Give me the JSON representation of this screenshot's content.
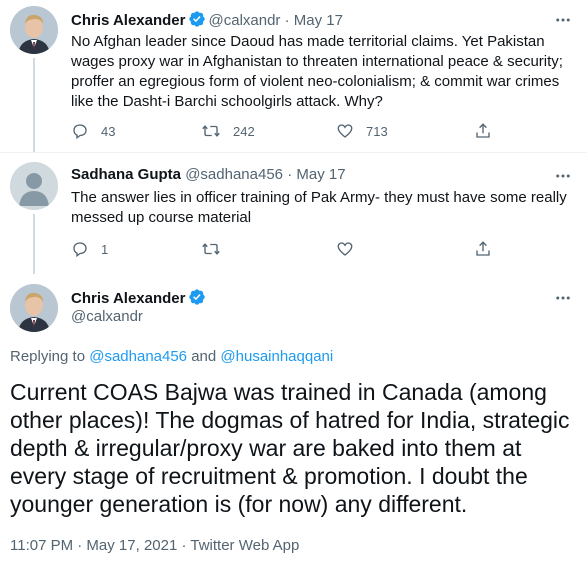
{
  "tweets": [
    {
      "name": "Chris Alexander",
      "handle": "@calxandr",
      "separator": "·",
      "date": "May 17",
      "text": "No Afghan leader since Daoud has made territorial claims. Yet Pakistan wages proxy war in Afghanistan to threaten international peace & security; proffer an egregious form of violent neo-colonialism; & commit war crimes like the Dasht-i Barchi schoolgirls attack. Why?",
      "replies": "43",
      "retweets": "242",
      "likes": "713"
    },
    {
      "name": "Sadhana Gupta",
      "handle": "@sadhana456",
      "separator": "·",
      "date": "May 17",
      "text": "The answer lies in officer training of Pak Army- they must have some really messed up course material",
      "replies": "1",
      "retweets": "",
      "likes": ""
    }
  ],
  "main_tweet": {
    "name": "Chris Alexander",
    "handle": "@calxandr",
    "replying_prefix": "Replying to",
    "mention_1": "@sadhana456",
    "and_word": "and",
    "mention_2": "@husainhaqqani",
    "text": "Current COAS Bajwa was trained in Canada (among other places)! The dogmas of hatred for India, strategic depth & irregular/proxy war are baked into them at every stage of recruitment & promotion. I doubt the younger generation is (for now) any different.",
    "timestamp": "11:07 PM · May 17, 2021 · Twitter Web App"
  },
  "colors": {
    "verified": "#1d9bf0",
    "secondary_text": "#536471",
    "link": "#1d9bf0",
    "thread_line": "#cfd9de"
  },
  "icons": [
    "verified-badge-icon",
    "more-icon",
    "reply-icon",
    "retweet-icon",
    "like-icon",
    "share-icon"
  ]
}
